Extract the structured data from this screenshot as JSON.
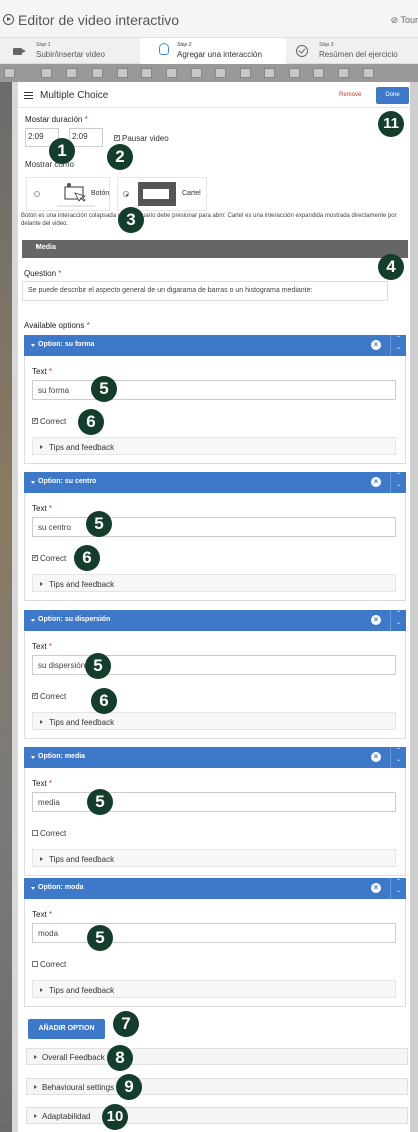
{
  "header": {
    "title": "Editor de video interactivo",
    "tour": "Tour"
  },
  "steps": [
    {
      "num": "Step 1",
      "label": "Subir/insertar video"
    },
    {
      "num": "Step 2",
      "label": "Agregar una interacción"
    },
    {
      "num": "Step 3",
      "label": "Resúmen del ejercicio"
    }
  ],
  "modal": {
    "title": "Multiple Choice",
    "remove": "Remove",
    "done": "Done",
    "duration_label": "Mostar duración",
    "time_start": "2:09",
    "time_end": "2:09",
    "pause_label": "Pausar video",
    "show_as_label": "Mostrar como",
    "mode_button": "Botón",
    "mode_poster": "Cartel",
    "description": "Botón es una interacción colapsada que el usuario debe presionar para abrir. Cartel es una interacción expandida mostrada directamente por delante del video.",
    "media": "Media",
    "question_label": "Question",
    "question_value": "Se puede describir el aspecto general de un digarama de barras o un histograma mediante:",
    "options_label": "Available options",
    "text_label": "Text",
    "correct_label": "Correct",
    "tips_label": "Tips and feedback",
    "add_option": "AÑADIR OPTION",
    "overall_feedback": "Overall Feedback",
    "behavioural": "Behavioural settings",
    "adaptability": "Adaptabilidad"
  },
  "options": [
    {
      "title": "Option: su forma",
      "text": "su forma",
      "correct": true
    },
    {
      "title": "Option: su centro",
      "text": "su centro",
      "correct": true
    },
    {
      "title": "Option: su dispersión",
      "text": "su dispersión",
      "correct": true
    },
    {
      "title": "Option: media",
      "text": "media",
      "correct": false
    },
    {
      "title": "Option: moda",
      "text": "moda",
      "correct": false
    }
  ],
  "markers": [
    "1",
    "2",
    "3",
    "4",
    "5",
    "5",
    "5",
    "5",
    "5",
    "6",
    "6",
    "6",
    "7",
    "8",
    "9",
    "10",
    "11"
  ]
}
